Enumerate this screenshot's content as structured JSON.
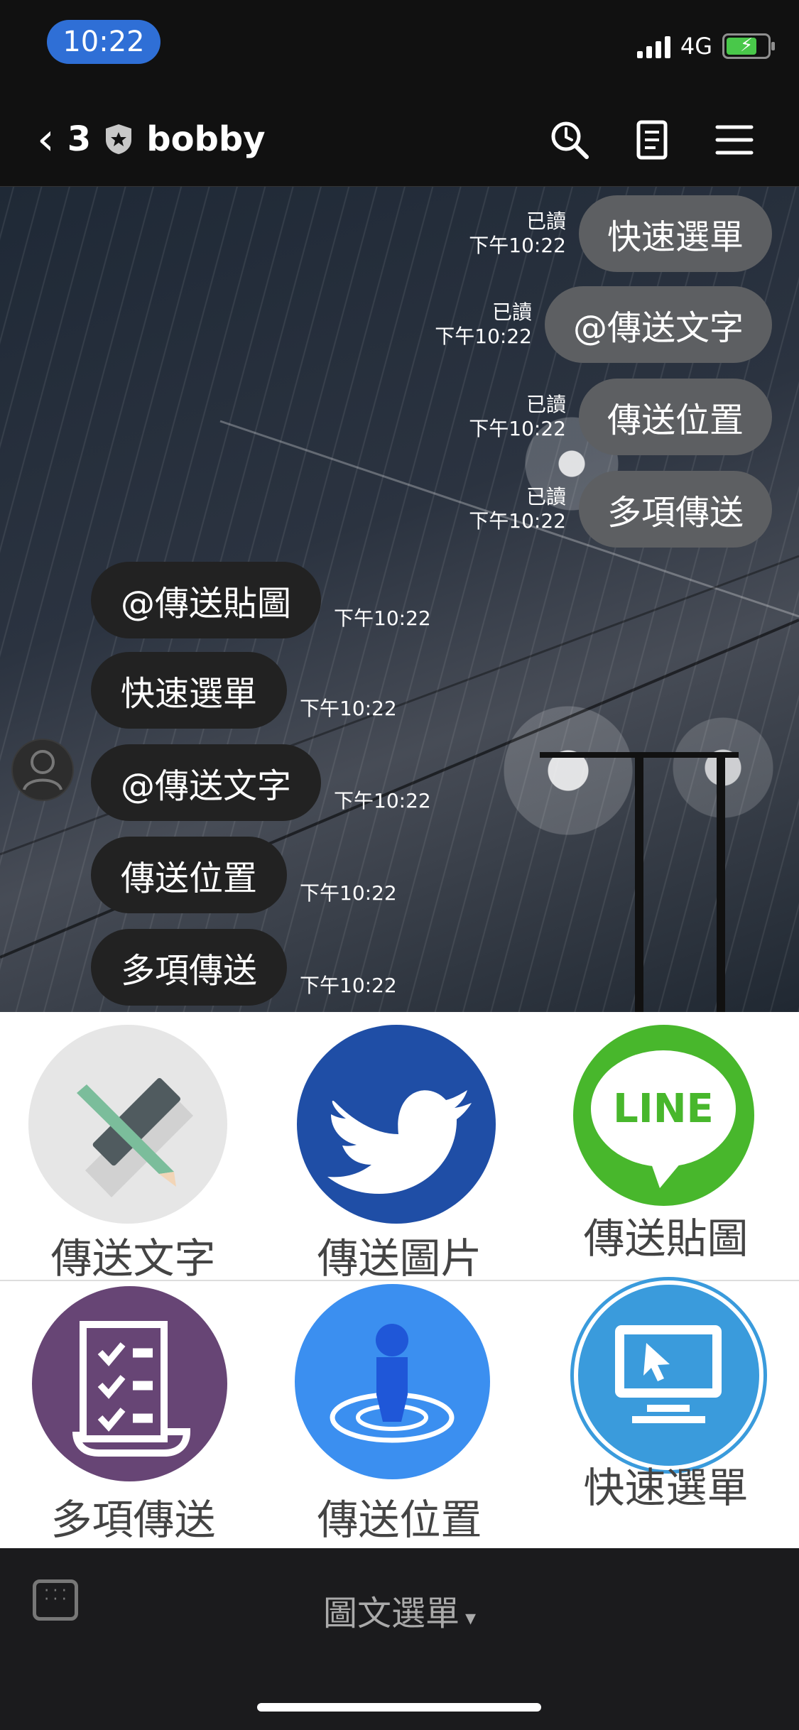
{
  "status": {
    "time": "10:22",
    "network": "4G"
  },
  "nav": {
    "back_count": "3",
    "title": "bobby"
  },
  "messages": {
    "outgoing": [
      {
        "text": "快速選單",
        "read": "已讀",
        "time": "下午10:22"
      },
      {
        "text": "@傳送文字",
        "read": "已讀",
        "time": "下午10:22"
      },
      {
        "text": "傳送位置",
        "read": "已讀",
        "time": "下午10:22"
      },
      {
        "text": "多項傳送",
        "read": "已讀",
        "time": "下午10:22"
      }
    ],
    "incoming": [
      {
        "text": "@傳送貼圖",
        "time": "下午10:22"
      },
      {
        "text": "快速選單",
        "time": "下午10:22"
      },
      {
        "text": "@傳送文字",
        "time": "下午10:22"
      },
      {
        "text": "傳送位置",
        "time": "下午10:22"
      },
      {
        "text": "多項傳送",
        "time": "下午10:22"
      }
    ]
  },
  "richmenu": {
    "items": [
      {
        "label": "傳送文字",
        "icon": "ruler-pencil-icon"
      },
      {
        "label": "傳送圖片",
        "icon": "twitter-bird-icon"
      },
      {
        "label": "傳送貼圖",
        "icon": "line-logo-icon"
      },
      {
        "label": "多項傳送",
        "icon": "checklist-icon"
      },
      {
        "label": "傳送位置",
        "icon": "location-person-icon"
      },
      {
        "label": "快速選單",
        "icon": "monitor-pointer-icon"
      }
    ],
    "logo_text": "LINE"
  },
  "bottom": {
    "title": "圖文選單",
    "dropdown": "▾"
  }
}
